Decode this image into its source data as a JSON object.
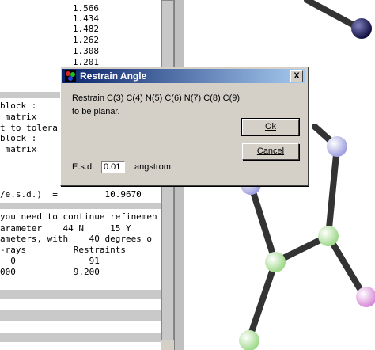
{
  "output_lines": {
    "bond_values": [
      "1.566",
      "1.434",
      "1.482",
      "1.262",
      "1.308",
      "1.201"
    ],
    "row_block1": "block :",
    "row_matrix1": " matrix",
    "row_tolera": "t to tolera",
    "row_block2": "block :",
    "row_matrix2": " matrix",
    "row_esd": "/e.s.d.)  =         10.9670",
    "row_continue": "you need to continue refinemen",
    "row_parameter": "arameter    44 N     15 Y",
    "row_parameters": "ameters, with    40 degrees o",
    "row_xrays": "-rays         Restraints",
    "row_counts1": "  0              91",
    "row_counts2": "000           9.200"
  },
  "dialog": {
    "title": "Restrain Angle",
    "close_label": "X",
    "message_line1": "Restrain  C(3) C(4) N(5) C(6) N(7) C(8) C(9)",
    "message_line2": "to be planar.",
    "ok_label": "Ok",
    "cancel_label": "Cancel",
    "esd_label": "E.s.d.",
    "esd_value": "0.01",
    "unit_label": "angstrom"
  },
  "colors": {
    "title_gradient_start": "#0a246a",
    "title_gradient_end": "#a6caf0",
    "dialog_face": "#d4d0c8",
    "bond": "#333333",
    "atom_c": "#d8f5c8",
    "atom_n": "#d8d8f5",
    "atom_dark": "#2a2a6a",
    "atom_pink": "#f5d8f5"
  },
  "molecule": {
    "atom_types": [
      "dark-atom",
      "n-atom",
      "n-atom",
      "c-atom",
      "c-atom",
      "c-atom",
      "pink-atom"
    ]
  }
}
